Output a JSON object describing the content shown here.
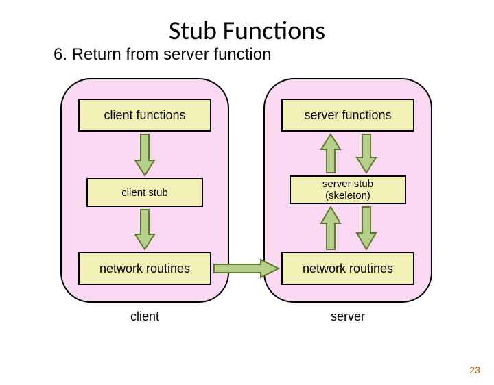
{
  "title": "Stub Functions",
  "subtitle": "6. Return from server function",
  "client": {
    "top": "client functions",
    "mid": "client stub",
    "bot": "network routines",
    "caption": "client"
  },
  "server": {
    "top": "server functions",
    "mid_line1": "server stub",
    "mid_line2": "(skeleton)",
    "bot": "network routines",
    "caption": "server"
  },
  "page": "23",
  "colors": {
    "arrow_fill": "#b6cf8a",
    "arrow_stroke": "#5b7a2a"
  }
}
